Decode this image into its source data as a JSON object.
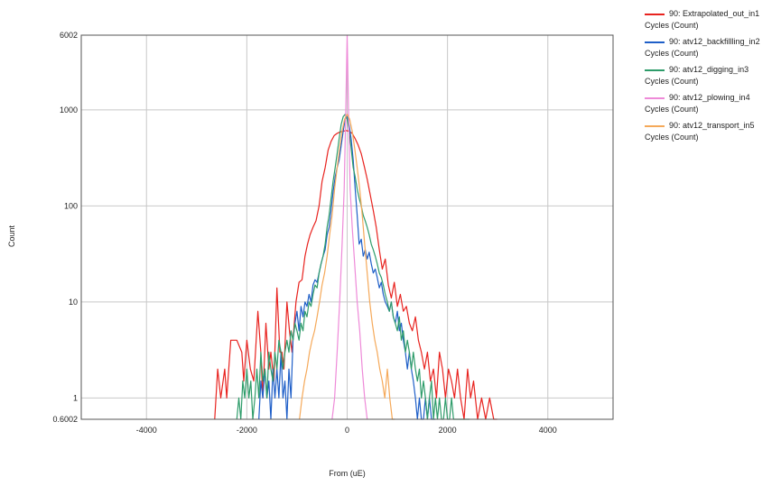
{
  "chart_data": {
    "type": "line",
    "title": "",
    "xlabel": "From (uE)",
    "ylabel": "Count",
    "xlim": [
      -5300,
      5300
    ],
    "ylim": [
      0.6002,
      6002
    ],
    "yscale": "log",
    "grid": true,
    "legend_position": "right",
    "x_ticks": [
      -4000,
      -2000,
      0,
      2000,
      4000
    ],
    "x_tick_labels": [
      "-4000",
      "-2000",
      "0",
      "2000",
      "4000"
    ],
    "y_ticks": [
      0.6002,
      1,
      10,
      100,
      1000,
      6002
    ],
    "y_tick_labels": [
      "0.6002",
      "1",
      "10",
      "100",
      "1000",
      "6002"
    ],
    "series": [
      {
        "name": "90: Extrapolated_out_in1",
        "unit": "Cycles (Count)",
        "color": "#e8231f",
        "x": [
          -2640,
          -2580,
          -2520,
          -2440,
          -2400,
          -2320,
          -2200,
          -2100,
          -2060,
          -2000,
          -1930,
          -1860,
          -1780,
          -1720,
          -1680,
          -1620,
          -1560,
          -1520,
          -1460,
          -1400,
          -1340,
          -1300,
          -1260,
          -1200,
          -1150,
          -1100,
          -1020,
          -960,
          -900,
          -840,
          -790,
          -740,
          -680,
          -620,
          -560,
          -500,
          -440,
          -380,
          -320,
          -260,
          -200,
          -140,
          -80,
          -20,
          40,
          100,
          160,
          220,
          280,
          340,
          400,
          460,
          520,
          580,
          640,
          700,
          760,
          820,
          880,
          940,
          1000,
          1060,
          1120,
          1180,
          1240,
          1300,
          1360,
          1420,
          1480,
          1540,
          1600,
          1660,
          1720,
          1780,
          1840,
          1900,
          1960,
          2020,
          2080,
          2140,
          2200,
          2260,
          2330,
          2400,
          2460,
          2520,
          2600,
          2680,
          2760,
          2840,
          2920,
          2990
        ],
        "y": [
          0.6002,
          2,
          1,
          2,
          1,
          4,
          4,
          3,
          1.5,
          4,
          2,
          1.5,
          8,
          3,
          1,
          6,
          2,
          3,
          1.5,
          14,
          3,
          3,
          2,
          10,
          5,
          3,
          10,
          16,
          17,
          30,
          40,
          50,
          60,
          70,
          100,
          180,
          250,
          380,
          470,
          540,
          570,
          590,
          600,
          610,
          600,
          570,
          500,
          430,
          350,
          260,
          190,
          130,
          90,
          60,
          35,
          22,
          28,
          15,
          11,
          16,
          9,
          12,
          8,
          9,
          6,
          5,
          7,
          4,
          3,
          2,
          3,
          1.5,
          2,
          1,
          3,
          2,
          1,
          2,
          1.5,
          1,
          2,
          1,
          0.6002,
          2,
          1,
          1.5,
          0.6002,
          1,
          0.6002,
          1,
          0.6002,
          0.6002
        ]
      },
      {
        "name": "90: atv12_backfillling_in2",
        "unit": "Cycles (Count)",
        "color": "#1f5fc8",
        "x": [
          -1760,
          -1720,
          -1680,
          -1640,
          -1600,
          -1560,
          -1520,
          -1480,
          -1440,
          -1400,
          -1360,
          -1320,
          -1280,
          -1240,
          -1200,
          -1160,
          -1120,
          -1080,
          -1040,
          -1000,
          -960,
          -920,
          -880,
          -840,
          -800,
          -760,
          -720,
          -680,
          -640,
          -600,
          -560,
          -520,
          -480,
          -440,
          -400,
          -360,
          -320,
          -280,
          -240,
          -200,
          -160,
          -120,
          -80,
          -40,
          0,
          40,
          80,
          120,
          160,
          200,
          240,
          280,
          320,
          360,
          400,
          440,
          480,
          520,
          560,
          600,
          640,
          680,
          720,
          760,
          800,
          840,
          880,
          920,
          960,
          1000,
          1040,
          1080,
          1120,
          1160,
          1200,
          1240,
          1280,
          1320,
          1360,
          1400,
          1440,
          1480,
          1520,
          1560,
          1600,
          1640,
          1680,
          1720,
          1760
        ],
        "y": [
          0.6002,
          1.5,
          1,
          2,
          1,
          1.5,
          0.6002,
          2,
          1,
          2,
          1,
          3,
          1,
          1.5,
          0.6002,
          2,
          1,
          4,
          6,
          8,
          5,
          9,
          7,
          10,
          9,
          12,
          10,
          15,
          17,
          16,
          20,
          25,
          30,
          35,
          50,
          60,
          90,
          140,
          200,
          250,
          300,
          420,
          600,
          800,
          850,
          700,
          500,
          300,
          150,
          80,
          40,
          45,
          30,
          35,
          28,
          33,
          25,
          20,
          22,
          18,
          14,
          16,
          12,
          10,
          9,
          8,
          10,
          7,
          6,
          8,
          5,
          6,
          4,
          3,
          2,
          3,
          2,
          1.5,
          1,
          0.6002,
          1,
          0.6002,
          0.6002,
          1,
          0.6002,
          1,
          0.6002,
          0.6002,
          0.6002
        ]
      },
      {
        "name": "90: atv12_digging_in3",
        "unit": "Cycles (Count)",
        "color": "#2e9c6a",
        "x": [
          -2200,
          -2160,
          -2120,
          -2080,
          -2040,
          -2000,
          -1960,
          -1920,
          -1880,
          -1840,
          -1800,
          -1760,
          -1720,
          -1680,
          -1640,
          -1600,
          -1560,
          -1520,
          -1480,
          -1440,
          -1400,
          -1360,
          -1320,
          -1280,
          -1240,
          -1200,
          -1160,
          -1120,
          -1080,
          -1040,
          -1000,
          -960,
          -920,
          -880,
          -840,
          -800,
          -760,
          -720,
          -680,
          -640,
          -600,
          -560,
          -520,
          -480,
          -440,
          -400,
          -360,
          -320,
          -280,
          -240,
          -200,
          -160,
          -120,
          -80,
          -40,
          0,
          40,
          80,
          120,
          160,
          200,
          240,
          280,
          320,
          360,
          400,
          440,
          480,
          520,
          560,
          600,
          640,
          680,
          720,
          760,
          800,
          840,
          880,
          920,
          960,
          1000,
          1040,
          1080,
          1120,
          1160,
          1200,
          1240,
          1280,
          1320,
          1360,
          1400,
          1440,
          1480,
          1520,
          1560,
          1600,
          1640,
          1680,
          1720,
          1760,
          1800,
          1840,
          1880,
          1920,
          1960,
          2000,
          2040,
          2080,
          2120,
          2160,
          2200,
          2240,
          2280,
          2320,
          2360,
          2400,
          2440
        ],
        "y": [
          0.6002,
          1,
          0.6002,
          1.5,
          1,
          2,
          1,
          1.5,
          0.6002,
          1,
          2,
          1,
          3,
          1.5,
          2,
          1,
          3,
          2,
          1.5,
          3,
          2,
          4,
          3,
          2,
          3,
          4,
          3,
          5,
          4,
          6,
          5,
          4,
          6,
          5,
          8,
          7,
          10,
          9,
          12,
          15,
          14,
          20,
          25,
          30,
          40,
          60,
          80,
          120,
          180,
          250,
          350,
          500,
          700,
          850,
          900,
          800,
          600,
          400,
          250,
          200,
          150,
          120,
          100,
          80,
          70,
          60,
          50,
          40,
          35,
          30,
          25,
          20,
          18,
          15,
          12,
          10,
          8,
          10,
          7,
          6,
          5,
          7,
          4,
          5,
          3,
          4,
          3,
          2,
          3,
          2,
          1.5,
          2,
          1,
          1.5,
          1,
          0.6002,
          1,
          1.5,
          0.6002,
          1,
          0.6002,
          1,
          0.6002,
          0.6002,
          1,
          0.6002,
          0.6002,
          1,
          0.6002,
          0.6002,
          0.6002,
          0.6002,
          0.6002,
          0.6002,
          0.6002,
          0.6002,
          0.6002
        ]
      },
      {
        "name": "90: atv12_plowing_in4",
        "unit": "Cycles (Count)",
        "color": "#ee8ad8",
        "x": [
          -300,
          -250,
          -200,
          -150,
          -100,
          -60,
          -30,
          0,
          30,
          60,
          100,
          150,
          200,
          250,
          300,
          350,
          400
        ],
        "y": [
          0.6002,
          1,
          3,
          10,
          40,
          150,
          800,
          6002,
          800,
          150,
          60,
          25,
          10,
          5,
          2,
          1,
          0.6002
        ]
      },
      {
        "name": "90: atv12_transport_in5",
        "unit": "Cycles (Count)",
        "color": "#f5a95a",
        "x": [
          -950,
          -900,
          -850,
          -800,
          -750,
          -700,
          -650,
          -600,
          -550,
          -500,
          -450,
          -400,
          -350,
          -300,
          -250,
          -200,
          -150,
          -100,
          -50,
          0,
          50,
          100,
          150,
          200,
          250,
          300,
          350,
          400,
          450,
          500,
          550,
          600,
          650,
          700,
          750,
          800,
          850,
          900,
          950
        ],
        "y": [
          0.6002,
          1,
          1.5,
          2,
          3,
          4,
          5,
          7,
          10,
          15,
          20,
          30,
          50,
          80,
          150,
          250,
          400,
          600,
          800,
          900,
          800,
          600,
          400,
          250,
          150,
          80,
          40,
          20,
          10,
          6,
          4,
          3,
          2,
          1.5,
          1,
          2,
          1,
          0.6002,
          0.6002
        ]
      }
    ]
  }
}
